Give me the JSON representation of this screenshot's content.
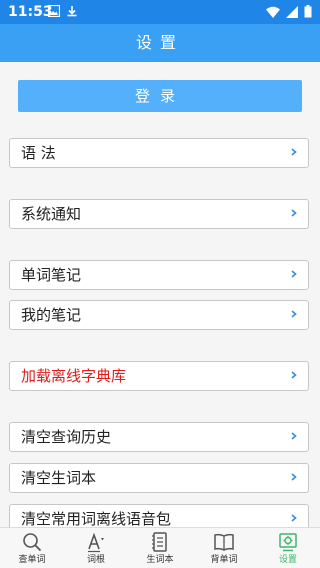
{
  "status_bar": {
    "time": "11:53",
    "icons_left": [
      "gallery-icon",
      "download-icon"
    ],
    "icons_right": [
      "wifi-icon",
      "signal-icon",
      "battery-icon"
    ]
  },
  "header": {
    "title": "设置"
  },
  "login": {
    "label": "登录"
  },
  "menu": {
    "items": [
      {
        "label": "语 法",
        "name": "grammar"
      },
      {
        "label": "系统通知",
        "name": "system-notification"
      },
      {
        "label": "单词笔记",
        "name": "word-notes"
      },
      {
        "label": "我的笔记",
        "name": "my-notes"
      },
      {
        "label": "加载离线字典库",
        "name": "load-offline-dictionary",
        "color": "#e11b1b"
      },
      {
        "label": "清空查询历史",
        "name": "clear-search-history"
      },
      {
        "label": "清空生词本",
        "name": "clear-vocabulary-book"
      },
      {
        "label": "清空常用词离线语音包",
        "name": "clear-offline-voice-pack"
      }
    ]
  },
  "bottom_nav": {
    "items": [
      {
        "label": "查单词",
        "icon": "search-icon"
      },
      {
        "label": "词根",
        "icon": "word-root-icon"
      },
      {
        "label": "生词本",
        "icon": "vocabulary-book-icon"
      },
      {
        "label": "背单词",
        "icon": "open-book-icon"
      },
      {
        "label": "设置",
        "icon": "settings-icon",
        "active": true
      }
    ],
    "active_color": "#3eb66b"
  },
  "colors": {
    "status_bar": "#1f86e8",
    "header": "#3aa0f3",
    "login_button": "#55b0fb",
    "background": "#f5f5f5"
  }
}
